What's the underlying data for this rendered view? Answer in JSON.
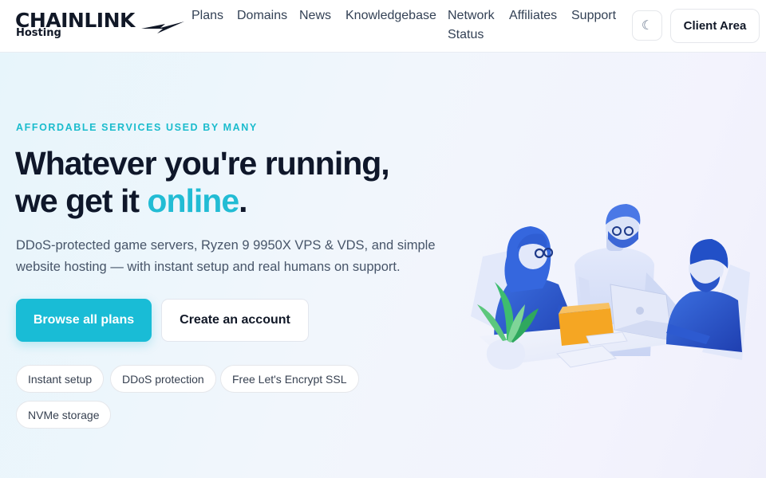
{
  "header": {
    "logo_main": "CHAINLINK",
    "logo_sub": "Hosting",
    "nav": [
      {
        "label": "Plans"
      },
      {
        "label": "Domains"
      },
      {
        "label": "News"
      },
      {
        "label": "Knowledgebase"
      },
      {
        "label": "Network Status"
      },
      {
        "label": "Affiliates"
      },
      {
        "label": "Support"
      }
    ],
    "theme_toggle_icon": "☾",
    "client_area_label": "Client Area"
  },
  "hero": {
    "eyebrow": "AFFORDABLE SERVICES USED BY MANY",
    "headline_line1": "Whatever you're running,",
    "headline_line2_prefix": "we get it ",
    "headline_accent": "online",
    "headline_suffix": ".",
    "subtext": "DDoS-protected game servers, Ryzen 9 9950X VPS & VDS, and simple website hosting — with instant setup and real humans on support.",
    "primary_button": "Browse all plans",
    "secondary_button": "Create an account",
    "features": [
      "Instant setup",
      "DDoS protection",
      "Free Let's Encrypt SSL",
      "NVMe storage"
    ],
    "accent_color": "#19bcd6"
  }
}
